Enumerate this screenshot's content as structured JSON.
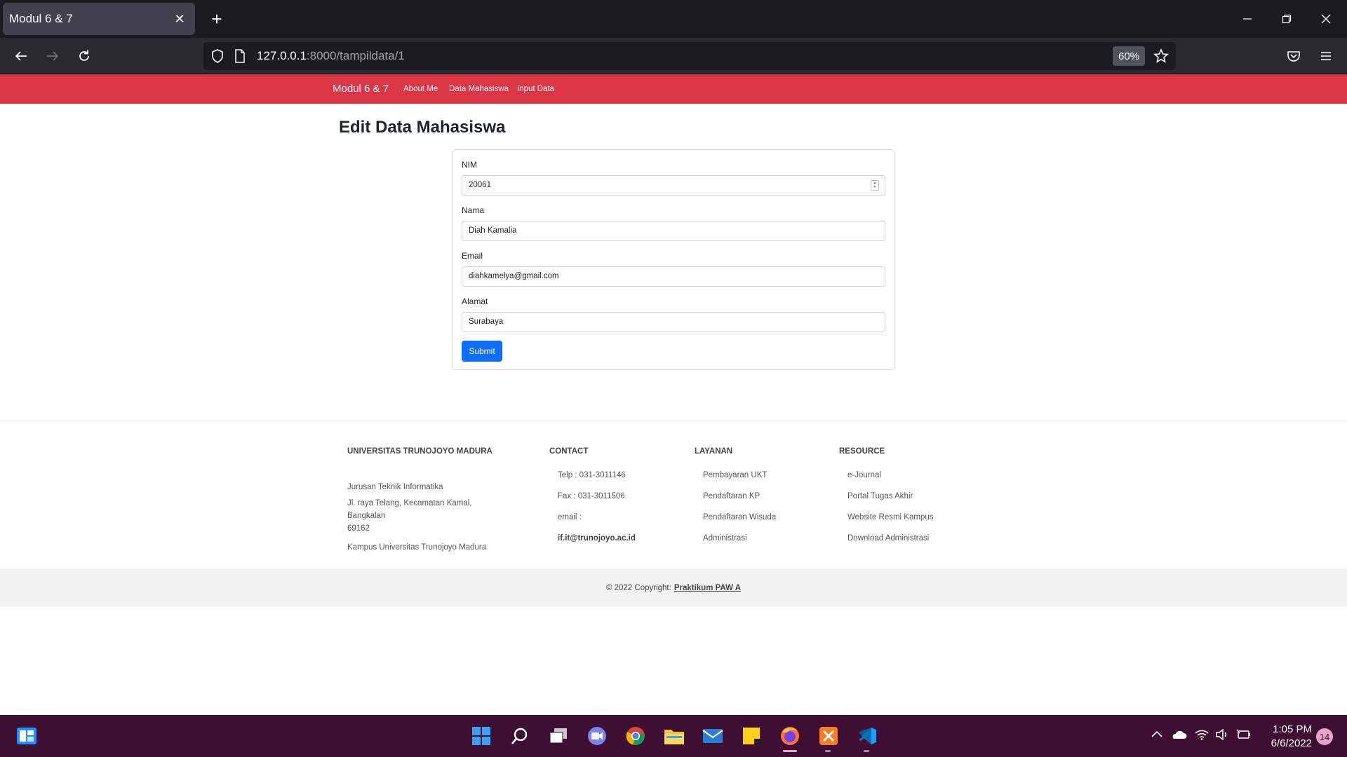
{
  "browser": {
    "tab_title": "Modul 6 & 7",
    "url_host": "127.0.0.1",
    "url_rest": ":8000/tampildata/1",
    "zoom": "60%"
  },
  "site_nav": {
    "brand": "Modul 6 & 7",
    "links": [
      "About Me",
      "Data Mahasiswa",
      "Input Data"
    ]
  },
  "page": {
    "title": "Edit Data Mahasiswa"
  },
  "form": {
    "nim_label": "NIM",
    "nim_value": "20061",
    "nama_label": "Nama",
    "nama_value": "Diah Kamalia",
    "email_label": "Email",
    "email_value": "diahkamelya@gmail.com",
    "alamat_label": "Alamat",
    "alamat_value": "Surabaya",
    "submit_label": "Submit"
  },
  "footer": {
    "col1": {
      "heading": "UNIVERSITAS TRUNOJOYO MADURA",
      "lines": [
        "Jurusan Teknik Informatika",
        "Jl. raya Telang, Kecamatan Kamal,",
        "Bangkalan",
        "69162",
        "Kampus Universitas Trunojoyo Madura"
      ]
    },
    "col2": {
      "heading": "CONTACT",
      "lines": [
        "Telp : 031-3011146",
        "Fax : 031-3011506",
        "email :",
        "if.it@trunojoyo.ac.id"
      ]
    },
    "col3": {
      "heading": "LAYANAN",
      "lines": [
        "Pembayaran UKT",
        "Pendaftaran KP",
        "Pendaftaran Wisuda",
        "Administrasi"
      ]
    },
    "col4": {
      "heading": "RESOURCE",
      "lines": [
        "e-Journal",
        "Portal Tugas Akhir",
        "Website Resmi Kampus",
        "Download Administrasi"
      ]
    },
    "copyright_prefix": "© 2022 Copyright:",
    "copyright_link": "Praktikum PAW A"
  },
  "taskbar": {
    "time": "1:05 PM",
    "date": "6/6/2022",
    "notifications": "14",
    "apps": [
      "start-icon",
      "search-icon",
      "task-view-icon",
      "chat-icon",
      "chrome-icon",
      "file-explorer-icon",
      "mail-icon",
      "sticky-notes-icon",
      "firefox-icon",
      "xampp-icon",
      "vscode-icon"
    ]
  }
}
